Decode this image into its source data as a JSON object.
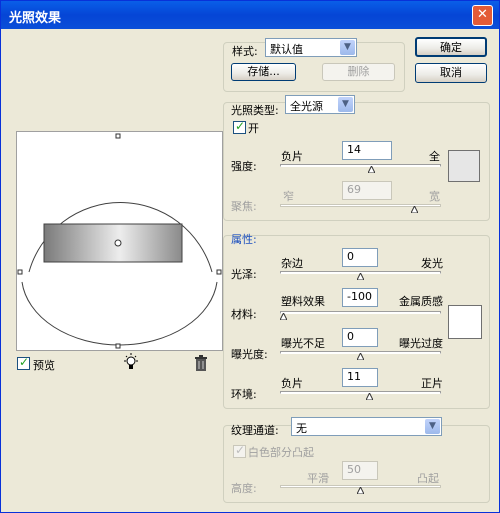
{
  "window": {
    "title": "光照效果",
    "close_glyph": "✕"
  },
  "style": {
    "label": "样式:",
    "value": "默认值",
    "save_label": "存储...",
    "delete_label": "删除"
  },
  "actions": {
    "ok": "确定",
    "cancel": "取消"
  },
  "light_type": {
    "label": "光照类型:",
    "value": "全光源",
    "on_label": "开",
    "on_checked": true,
    "intensity": {
      "label": "强度:",
      "min_label": "负片",
      "max_label": "全",
      "value": "14",
      "level": 0.57
    },
    "focus": {
      "label": "聚焦:",
      "min_label": "窄",
      "max_label": "宽",
      "value": "69",
      "level": 0.85
    }
  },
  "properties": {
    "title": "属性:",
    "gloss": {
      "label": "光泽:",
      "min_label": "杂边",
      "max_label": "发光",
      "value": "0",
      "level": 0.5
    },
    "material": {
      "label": "材料:",
      "min_label": "塑料效果",
      "max_label": "金属质感",
      "value": "-100",
      "level": 0.0
    },
    "exposure": {
      "label": "曝光度:",
      "min_label": "曝光不足",
      "max_label": "曝光过度",
      "value": "0",
      "level": 0.5
    },
    "ambience": {
      "label": "环境:",
      "min_label": "负片",
      "max_label": "正片",
      "value": "11",
      "level": 0.56
    }
  },
  "texture": {
    "label": "纹理通道:",
    "value": "无",
    "white_high_label": "白色部分凸起",
    "white_high_checked": true,
    "height": {
      "label": "高度:",
      "min_label": "平滑",
      "max_label": "凸起",
      "value": "50",
      "level": 0.5
    }
  },
  "preview": {
    "label": "预览",
    "checked": true
  },
  "colors": {
    "light_swatch": "#E6E6E6",
    "ambience_swatch": "#FFFFFF"
  }
}
